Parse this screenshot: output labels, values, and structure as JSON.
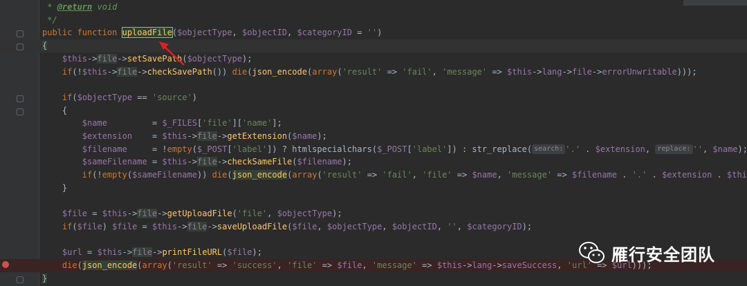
{
  "lines": [
    {
      "segments": [
        {
          "t": " * ",
          "c": "c"
        },
        {
          "t": "@return",
          "c": "ctag"
        },
        {
          "t": " void",
          "c": "c"
        }
      ]
    },
    {
      "segments": [
        {
          "t": " */",
          "c": "c"
        }
      ]
    },
    {
      "segments": [
        {
          "t": "public function ",
          "c": "kw"
        },
        {
          "t": "uploadFile",
          "c": "box"
        },
        {
          "t": "(",
          "c": "p"
        },
        {
          "t": "$objectType",
          "c": "v"
        },
        {
          "t": ", ",
          "c": "p"
        },
        {
          "t": "$objectID",
          "c": "v"
        },
        {
          "t": ", ",
          "c": "p"
        },
        {
          "t": "$categoryID",
          "c": "v"
        },
        {
          "t": " = ",
          "c": "p"
        },
        {
          "t": "''",
          "c": "s"
        },
        {
          "t": ")",
          "c": "p"
        }
      ]
    },
    {
      "segments": [
        {
          "t": "{",
          "c": "yb"
        }
      ]
    },
    {
      "segments": [
        {
          "t": "    ",
          "c": "p"
        },
        {
          "t": "$this",
          "c": "v"
        },
        {
          "t": "->",
          "c": "p"
        },
        {
          "t": "file",
          "c": "v yb"
        },
        {
          "t": "->",
          "c": "p"
        },
        {
          "t": "setSavePath",
          "c": "fn"
        },
        {
          "t": "(",
          "c": "p"
        },
        {
          "t": "$objectType",
          "c": "v"
        },
        {
          "t": ");",
          "c": "p"
        }
      ]
    },
    {
      "segments": [
        {
          "t": "    if",
          "c": "kw"
        },
        {
          "t": "(!",
          "c": "p"
        },
        {
          "t": "$this",
          "c": "v"
        },
        {
          "t": "->",
          "c": "p"
        },
        {
          "t": "file",
          "c": "v yb"
        },
        {
          "t": "->",
          "c": "p"
        },
        {
          "t": "checkSavePath",
          "c": "fn"
        },
        {
          "t": "()) ",
          "c": "p"
        },
        {
          "t": "die",
          "c": "kw"
        },
        {
          "t": "(",
          "c": "p"
        },
        {
          "t": "json_encode",
          "c": "fn"
        },
        {
          "t": "(",
          "c": "p"
        },
        {
          "t": "array",
          "c": "kw"
        },
        {
          "t": "(",
          "c": "p"
        },
        {
          "t": "'result'",
          "c": "s"
        },
        {
          "t": " => ",
          "c": "p"
        },
        {
          "t": "'fail'",
          "c": "s"
        },
        {
          "t": ", ",
          "c": "p"
        },
        {
          "t": "'message'",
          "c": "s"
        },
        {
          "t": " => ",
          "c": "p"
        },
        {
          "t": "$this",
          "c": "v"
        },
        {
          "t": "->",
          "c": "p"
        },
        {
          "t": "lang",
          "c": "v"
        },
        {
          "t": "->",
          "c": "p"
        },
        {
          "t": "file",
          "c": "v"
        },
        {
          "t": "->",
          "c": "p"
        },
        {
          "t": "errorUnwritable",
          "c": "v"
        },
        {
          "t": ")));",
          "c": "p"
        }
      ]
    },
    {
      "segments": []
    },
    {
      "segments": [
        {
          "t": "    if",
          "c": "kw"
        },
        {
          "t": "(",
          "c": "p"
        },
        {
          "t": "$objectType",
          "c": "v"
        },
        {
          "t": " == ",
          "c": "p"
        },
        {
          "t": "'source'",
          "c": "s"
        },
        {
          "t": ")",
          "c": "p"
        }
      ]
    },
    {
      "segments": [
        {
          "t": "    {",
          "c": "p"
        }
      ]
    },
    {
      "segments": [
        {
          "t": "        ",
          "c": "p"
        },
        {
          "t": "$name",
          "c": "v"
        },
        {
          "t": "         = ",
          "c": "p"
        },
        {
          "t": "$_FILES",
          "c": "v"
        },
        {
          "t": "[",
          "c": "p"
        },
        {
          "t": "'file'",
          "c": "s"
        },
        {
          "t": "][",
          "c": "p"
        },
        {
          "t": "'name'",
          "c": "s"
        },
        {
          "t": "];",
          "c": "p"
        }
      ]
    },
    {
      "segments": [
        {
          "t": "        ",
          "c": "p"
        },
        {
          "t": "$extension",
          "c": "v"
        },
        {
          "t": "    = ",
          "c": "p"
        },
        {
          "t": "$this",
          "c": "v"
        },
        {
          "t": "->",
          "c": "p"
        },
        {
          "t": "file",
          "c": "v yb"
        },
        {
          "t": "->",
          "c": "p"
        },
        {
          "t": "getExtension",
          "c": "fn"
        },
        {
          "t": "(",
          "c": "p"
        },
        {
          "t": "$name",
          "c": "v"
        },
        {
          "t": ");",
          "c": "p"
        }
      ]
    },
    {
      "segments": [
        {
          "t": "        ",
          "c": "p"
        },
        {
          "t": "$filename",
          "c": "v"
        },
        {
          "t": "     = !",
          "c": "p"
        },
        {
          "t": "empty",
          "c": "kw"
        },
        {
          "t": "(",
          "c": "p"
        },
        {
          "t": "$_POST",
          "c": "v"
        },
        {
          "t": "[",
          "c": "p"
        },
        {
          "t": "'label'",
          "c": "s"
        },
        {
          "t": "]) ? htmlspecialchars(",
          "c": "p"
        },
        {
          "t": "$_POST",
          "c": "v"
        },
        {
          "t": "[",
          "c": "p"
        },
        {
          "t": "'label'",
          "c": "s"
        },
        {
          "t": "]) : str_replace(",
          "c": "p"
        },
        {
          "t": "search:",
          "c": "hint"
        },
        {
          "t": "'.'",
          "c": "s"
        },
        {
          "t": " . ",
          "c": "p"
        },
        {
          "t": "$extension",
          "c": "v"
        },
        {
          "t": ", ",
          "c": "p"
        },
        {
          "t": "replace:",
          "c": "hint"
        },
        {
          "t": "''",
          "c": "s"
        },
        {
          "t": ", ",
          "c": "p"
        },
        {
          "t": "$name",
          "c": "v"
        },
        {
          "t": ");",
          "c": "p"
        }
      ]
    },
    {
      "segments": [
        {
          "t": "        ",
          "c": "p"
        },
        {
          "t": "$sameFilename",
          "c": "v"
        },
        {
          "t": " = ",
          "c": "p"
        },
        {
          "t": "$this",
          "c": "v"
        },
        {
          "t": "->",
          "c": "p"
        },
        {
          "t": "file",
          "c": "v yb"
        },
        {
          "t": "->",
          "c": "p"
        },
        {
          "t": "checkSameFile",
          "c": "fn"
        },
        {
          "t": "(",
          "c": "p"
        },
        {
          "t": "$filename",
          "c": "v"
        },
        {
          "t": ");",
          "c": "p"
        }
      ]
    },
    {
      "segments": [
        {
          "t": "        if",
          "c": "kw"
        },
        {
          "t": "(!",
          "c": "p"
        },
        {
          "t": "empty",
          "c": "kw"
        },
        {
          "t": "(",
          "c": "p"
        },
        {
          "t": "$sameFilename",
          "c": "v"
        },
        {
          "t": ")) ",
          "c": "p"
        },
        {
          "t": "die",
          "c": "kw"
        },
        {
          "t": "(",
          "c": "p"
        },
        {
          "t": "json_encode",
          "c": "fn yb"
        },
        {
          "t": "(",
          "c": "p"
        },
        {
          "t": "array",
          "c": "kw"
        },
        {
          "t": "(",
          "c": "p"
        },
        {
          "t": "'result'",
          "c": "s"
        },
        {
          "t": " => ",
          "c": "p"
        },
        {
          "t": "'fail'",
          "c": "s"
        },
        {
          "t": ", ",
          "c": "p"
        },
        {
          "t": "'file'",
          "c": "s"
        },
        {
          "t": " => ",
          "c": "p"
        },
        {
          "t": "$name",
          "c": "v"
        },
        {
          "t": ", ",
          "c": "p"
        },
        {
          "t": "'message'",
          "c": "s"
        },
        {
          "t": " => ",
          "c": "p"
        },
        {
          "t": "$filename",
          "c": "v"
        },
        {
          "t": " . ",
          "c": "p"
        },
        {
          "t": "'.'",
          "c": "s"
        },
        {
          "t": " . ",
          "c": "p"
        },
        {
          "t": "$extension",
          "c": "v"
        },
        {
          "t": " . ",
          "c": "p"
        },
        {
          "t": "$this-",
          "c": "v"
        }
      ]
    },
    {
      "segments": [
        {
          "t": "    }",
          "c": "p"
        }
      ]
    },
    {
      "segments": []
    },
    {
      "segments": [
        {
          "t": "    ",
          "c": "p"
        },
        {
          "t": "$file",
          "c": "v"
        },
        {
          "t": " = ",
          "c": "p"
        },
        {
          "t": "$this",
          "c": "v"
        },
        {
          "t": "->",
          "c": "p"
        },
        {
          "t": "file",
          "c": "v yb"
        },
        {
          "t": "->",
          "c": "p"
        },
        {
          "t": "getUploadFile",
          "c": "fn"
        },
        {
          "t": "(",
          "c": "p"
        },
        {
          "t": "'file'",
          "c": "s"
        },
        {
          "t": ", ",
          "c": "p"
        },
        {
          "t": "$objectType",
          "c": "v"
        },
        {
          "t": ");",
          "c": "p"
        }
      ]
    },
    {
      "segments": [
        {
          "t": "    if",
          "c": "kw"
        },
        {
          "t": "(",
          "c": "p"
        },
        {
          "t": "$file",
          "c": "v"
        },
        {
          "t": ") ",
          "c": "p"
        },
        {
          "t": "$file",
          "c": "v"
        },
        {
          "t": " = ",
          "c": "p"
        },
        {
          "t": "$this",
          "c": "v"
        },
        {
          "t": "->",
          "c": "p"
        },
        {
          "t": "file",
          "c": "v yb"
        },
        {
          "t": "->",
          "c": "p"
        },
        {
          "t": "saveUploadFile",
          "c": "fn"
        },
        {
          "t": "(",
          "c": "p"
        },
        {
          "t": "$file",
          "c": "v"
        },
        {
          "t": ", ",
          "c": "p"
        },
        {
          "t": "$objectType",
          "c": "v"
        },
        {
          "t": ", ",
          "c": "p"
        },
        {
          "t": "$objectID",
          "c": "v"
        },
        {
          "t": ", ",
          "c": "p"
        },
        {
          "t": "''",
          "c": "s"
        },
        {
          "t": ", ",
          "c": "p"
        },
        {
          "t": "$categoryID",
          "c": "v"
        },
        {
          "t": ");",
          "c": "p"
        }
      ]
    },
    {
      "segments": []
    },
    {
      "segments": [
        {
          "t": "    ",
          "c": "p"
        },
        {
          "t": "$url",
          "c": "v"
        },
        {
          "t": " = ",
          "c": "p"
        },
        {
          "t": "$this",
          "c": "v"
        },
        {
          "t": "->",
          "c": "p"
        },
        {
          "t": "file",
          "c": "v yb"
        },
        {
          "t": "->",
          "c": "p"
        },
        {
          "t": "printFileURL",
          "c": "fn"
        },
        {
          "t": "(",
          "c": "p"
        },
        {
          "t": "$file",
          "c": "v"
        },
        {
          "t": ");",
          "c": "p"
        }
      ]
    },
    {
      "segments": [
        {
          "t": "    die",
          "c": "kw"
        },
        {
          "t": "(",
          "c": "p"
        },
        {
          "t": "json_encode",
          "c": "fn yb"
        },
        {
          "t": "(",
          "c": "p"
        },
        {
          "t": "array",
          "c": "kw"
        },
        {
          "t": "(",
          "c": "p"
        },
        {
          "t": "'result'",
          "c": "s"
        },
        {
          "t": " => ",
          "c": "p"
        },
        {
          "t": "'success'",
          "c": "s"
        },
        {
          "t": ", ",
          "c": "p"
        },
        {
          "t": "'file'",
          "c": "s"
        },
        {
          "t": " => ",
          "c": "p"
        },
        {
          "t": "$file",
          "c": "v"
        },
        {
          "t": ", ",
          "c": "p"
        },
        {
          "t": "'message'",
          "c": "s"
        },
        {
          "t": " => ",
          "c": "p"
        },
        {
          "t": "$this",
          "c": "v"
        },
        {
          "t": "->",
          "c": "p"
        },
        {
          "t": "lang",
          "c": "v"
        },
        {
          "t": "->",
          "c": "p"
        },
        {
          "t": "saveSuccess",
          "c": "v"
        },
        {
          "t": ", ",
          "c": "p"
        },
        {
          "t": "'url'",
          "c": "s"
        },
        {
          "t": " => ",
          "c": "p"
        },
        {
          "t": "$url",
          "c": "v"
        },
        {
          "t": ")));",
          "c": "p"
        }
      ]
    },
    {
      "segments": [
        {
          "t": "}",
          "c": "yb"
        }
      ]
    }
  ],
  "watermark": {
    "text": "雁行安全团队",
    "icon": "wechat-icon"
  },
  "colors": {
    "background": "#2b2b2b",
    "keyword": "#cc7832",
    "variable": "#9876aa",
    "function": "#ffc66d",
    "string": "#6a8759",
    "comment": "#629755",
    "breakpoint": "#c75450"
  },
  "indicators": {
    "breakpoint_line": 21,
    "current_line": 4,
    "annotated_function": "uploadFile"
  }
}
